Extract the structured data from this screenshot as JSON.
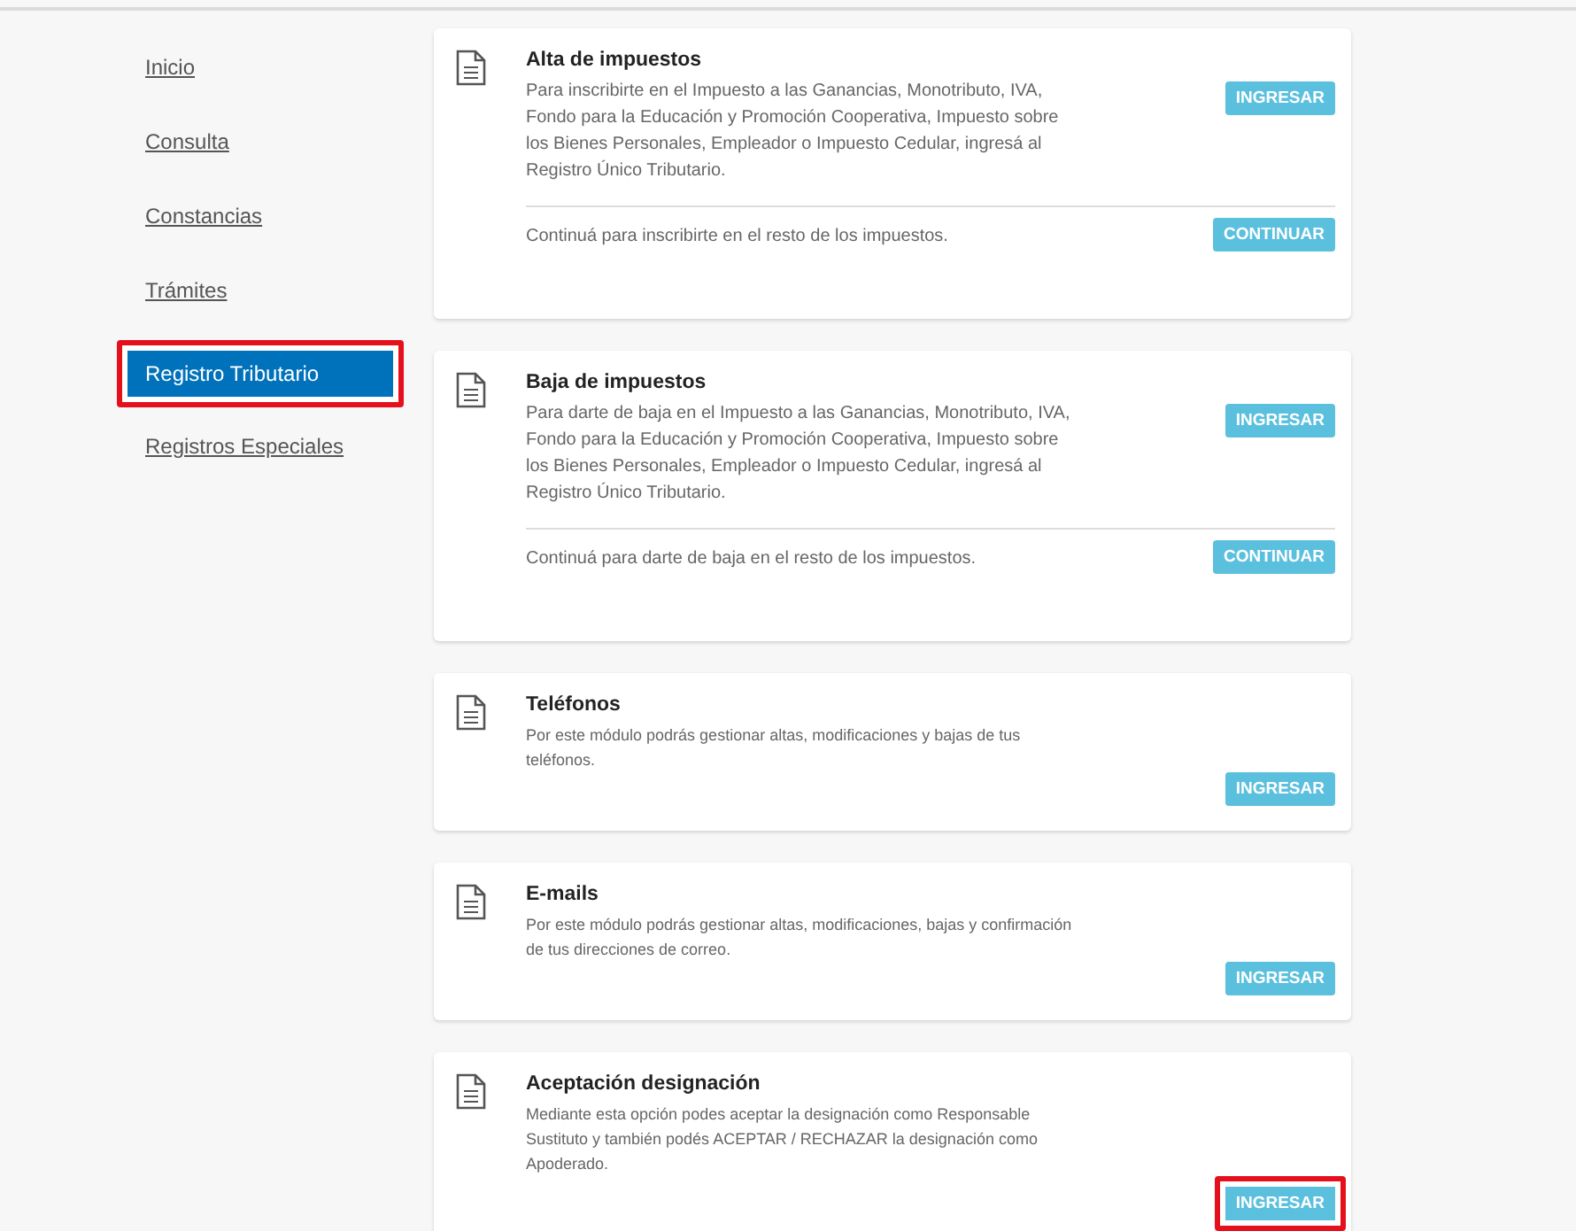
{
  "sidebar": {
    "items": [
      {
        "label": "Inicio",
        "selected": false,
        "highlighted": false
      },
      {
        "label": "Consulta",
        "selected": false,
        "highlighted": false
      },
      {
        "label": "Constancias",
        "selected": false,
        "highlighted": false
      },
      {
        "label": "Trámites",
        "selected": false,
        "highlighted": false
      },
      {
        "label": "Registro Tributario",
        "selected": true,
        "highlighted": true
      },
      {
        "label": "Registros Especiales",
        "selected": false,
        "highlighted": false
      }
    ]
  },
  "cards": [
    {
      "kind": "extended",
      "title": "Alta de impuestos",
      "description": "Para inscribirte en el Impuesto a las Ganancias, Monotributo, IVA, Fondo para la Educación y Promoción Cooperativa, Impuesto sobre los Bienes Personales, Empleador o Impuesto Cedular, ingresá al Registro Único Tributario.",
      "button": {
        "label": "INGRESAR",
        "highlighted": false
      },
      "extra_text": "Continuá para inscribirte en el resto de los impuestos.",
      "extra_button": "CONTINUAR"
    },
    {
      "kind": "extended",
      "title": "Baja de impuestos",
      "description": "Para darte de baja en el Impuesto a las Ganancias, Monotributo, IVA, Fondo para la Educación y Promoción Cooperativa, Impuesto sobre los Bienes Personales, Empleador o Impuesto Cedular, ingresá al Registro Único Tributario.",
      "button": {
        "label": "INGRESAR",
        "highlighted": false
      },
      "extra_text": "Continuá para darte de baja en el resto de los impuestos.",
      "extra_button": "CONTINUAR"
    },
    {
      "kind": "simple",
      "title": "Teléfonos",
      "description": "Por este módulo podrás gestionar altas, modificaciones y bajas de tus teléfonos.",
      "button": {
        "label": "INGRESAR",
        "highlighted": false
      }
    },
    {
      "kind": "simple",
      "title": "E-mails",
      "description": "Por este módulo podrás gestionar altas, modificaciones, bajas y confirmación de tus direcciones de correo.",
      "button": {
        "label": "INGRESAR",
        "highlighted": false
      }
    },
    {
      "kind": "simple",
      "title": "Aceptación designación",
      "description": "Mediante esta opción podes aceptar la designación como Responsable Sustituto y también podés ACEPTAR / RECHAZAR la designación como Apoderado.",
      "button": {
        "label": "INGRESAR",
        "highlighted": true
      }
    }
  ]
}
